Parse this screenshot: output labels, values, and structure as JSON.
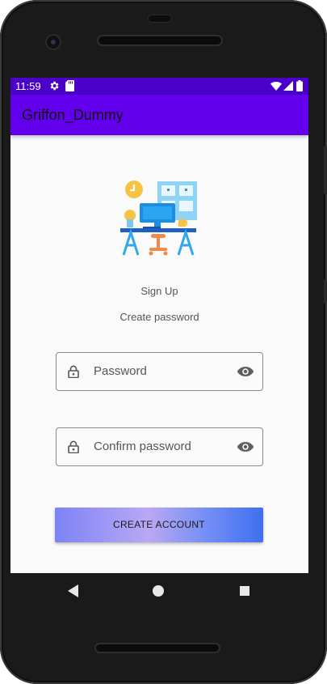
{
  "status_bar": {
    "time": "11:59",
    "icons": [
      "gear-icon",
      "sd-card-icon",
      "wifi-icon",
      "signal-icon",
      "battery-icon"
    ]
  },
  "app_bar": {
    "title": "Griffon_Dummy",
    "color": "#6200ee"
  },
  "page": {
    "heading": "Sign Up",
    "subheading": "Create password"
  },
  "form": {
    "password": {
      "placeholder": "Password",
      "value": "",
      "leading_icon": "lock-icon",
      "trailing_icon": "eye-icon"
    },
    "confirm_password": {
      "placeholder": "Confirm password",
      "value": "",
      "leading_icon": "lock-icon",
      "trailing_icon": "eye-icon"
    },
    "submit_label": "CREATE ACCOUNT"
  },
  "navigation_bar": {
    "icons": [
      "back-icon",
      "home-icon",
      "recents-icon"
    ]
  },
  "colors": {
    "status_bar": "#4a00c8",
    "app_bar": "#6200ee",
    "background": "#fafafa",
    "button_gradient_start": "#7d83f7",
    "button_gradient_end": "#3f6ff0"
  }
}
